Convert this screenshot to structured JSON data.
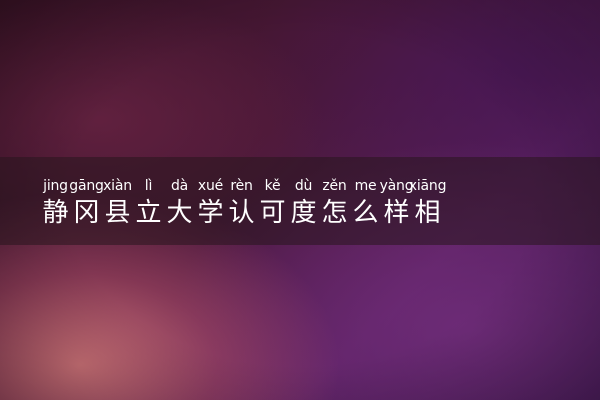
{
  "title": {
    "characters": [
      {
        "pinyin": "jing",
        "hanzi": "静"
      },
      {
        "pinyin": "gāng",
        "hanzi": "冈"
      },
      {
        "pinyin": "xiàn",
        "hanzi": "县"
      },
      {
        "pinyin": "lì",
        "hanzi": "立"
      },
      {
        "pinyin": "dà",
        "hanzi": "大"
      },
      {
        "pinyin": "xué",
        "hanzi": "学"
      },
      {
        "pinyin": "rèn",
        "hanzi": "认"
      },
      {
        "pinyin": "kě",
        "hanzi": "可"
      },
      {
        "pinyin": "dù",
        "hanzi": "度"
      },
      {
        "pinyin": "zěn",
        "hanzi": "怎"
      },
      {
        "pinyin": "me",
        "hanzi": "么"
      },
      {
        "pinyin": "yàng",
        "hanzi": "样"
      },
      {
        "pinyin": "xiāng",
        "hanzi": "相"
      }
    ]
  },
  "colors": {
    "text": "#ffffff",
    "banner": "rgba(40,22,30,0.55)"
  }
}
